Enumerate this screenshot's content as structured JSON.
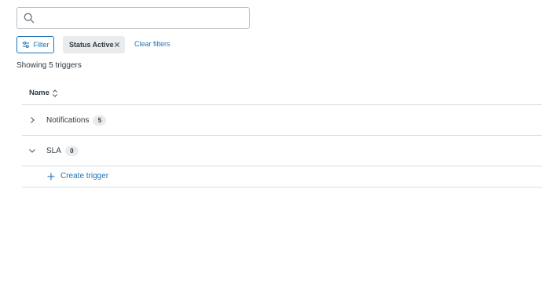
{
  "search": {
    "value": "",
    "placeholder": ""
  },
  "filters": {
    "filter_button_label": "Filter",
    "active_chip_label": "Status Active",
    "clear_label": "Clear filters"
  },
  "summary": {
    "count_text": "Showing 5 triggers"
  },
  "table": {
    "header": {
      "name_label": "Name"
    },
    "groups": [
      {
        "label": "Notifications",
        "count": "5",
        "expanded": false
      },
      {
        "label": "SLA",
        "count": "0",
        "expanded": true
      }
    ],
    "create_label": "Create trigger"
  },
  "colors": {
    "accent": "#1f73b7",
    "text": "#2f3941",
    "border": "#d8dcde",
    "chip_bg": "#e9ebed"
  },
  "icons": [
    "search-icon",
    "filter-icon",
    "close-icon",
    "sort-icon",
    "chevron-right-icon",
    "chevron-down-icon",
    "plus-icon"
  ]
}
